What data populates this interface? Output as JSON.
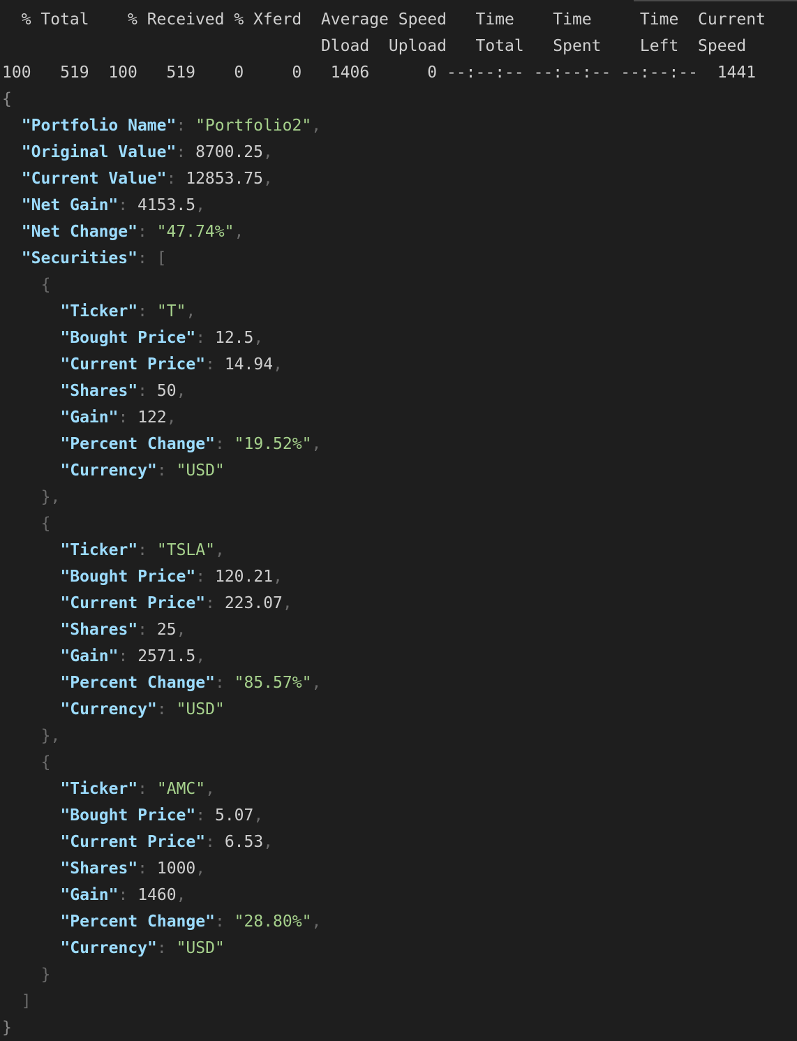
{
  "terminal": {
    "header_line_1": "  % Total    % Received % Xferd  Average Speed   Time    Time     Time  Current",
    "header_line_2": "                                 Dload  Upload   Total   Spent    Left  Speed",
    "progress_line": "100   519  100   519    0     0   1406      0 --:--:-- --:--:-- --:--:--  1441"
  },
  "json": {
    "open_brace": "{",
    "portfolio_fields": [
      {
        "key": "\"Portfolio Name\"",
        "value": "\"Portfolio2\"",
        "type": "str",
        "comma": ","
      },
      {
        "key": "\"Original Value\"",
        "value": "8700.25",
        "type": "num",
        "comma": ","
      },
      {
        "key": "\"Current Value\"",
        "value": "12853.75",
        "type": "num",
        "comma": ","
      },
      {
        "key": "\"Net Gain\"",
        "value": "4153.5",
        "type": "num",
        "comma": ","
      },
      {
        "key": "\"Net Change\"",
        "value": "\"47.74%\"",
        "type": "str",
        "comma": ","
      }
    ],
    "securities_key": "\"Securities\"",
    "securities_open": "[",
    "securities": [
      {
        "open": "{",
        "fields": [
          {
            "key": "\"Ticker\"",
            "value": "\"T\"",
            "type": "str",
            "comma": ","
          },
          {
            "key": "\"Bought Price\"",
            "value": "12.5",
            "type": "num",
            "comma": ","
          },
          {
            "key": "\"Current Price\"",
            "value": "14.94",
            "type": "num",
            "comma": ","
          },
          {
            "key": "\"Shares\"",
            "value": "50",
            "type": "num",
            "comma": ","
          },
          {
            "key": "\"Gain\"",
            "value": "122",
            "type": "num",
            "comma": ","
          },
          {
            "key": "\"Percent Change\"",
            "value": "\"19.52%\"",
            "type": "str",
            "comma": ","
          },
          {
            "key": "\"Currency\"",
            "value": "\"USD\"",
            "type": "str",
            "comma": ""
          }
        ],
        "close": "},"
      },
      {
        "open": "{",
        "fields": [
          {
            "key": "\"Ticker\"",
            "value": "\"TSLA\"",
            "type": "str",
            "comma": ","
          },
          {
            "key": "\"Bought Price\"",
            "value": "120.21",
            "type": "num",
            "comma": ","
          },
          {
            "key": "\"Current Price\"",
            "value": "223.07",
            "type": "num",
            "comma": ","
          },
          {
            "key": "\"Shares\"",
            "value": "25",
            "type": "num",
            "comma": ","
          },
          {
            "key": "\"Gain\"",
            "value": "2571.5",
            "type": "num",
            "comma": ","
          },
          {
            "key": "\"Percent Change\"",
            "value": "\"85.57%\"",
            "type": "str",
            "comma": ","
          },
          {
            "key": "\"Currency\"",
            "value": "\"USD\"",
            "type": "str",
            "comma": ""
          }
        ],
        "close": "},"
      },
      {
        "open": "{",
        "fields": [
          {
            "key": "\"Ticker\"",
            "value": "\"AMC\"",
            "type": "str",
            "comma": ","
          },
          {
            "key": "\"Bought Price\"",
            "value": "5.07",
            "type": "num",
            "comma": ","
          },
          {
            "key": "\"Current Price\"",
            "value": "6.53",
            "type": "num",
            "comma": ","
          },
          {
            "key": "\"Shares\"",
            "value": "1000",
            "type": "num",
            "comma": ","
          },
          {
            "key": "\"Gain\"",
            "value": "1460",
            "type": "num",
            "comma": ","
          },
          {
            "key": "\"Percent Change\"",
            "value": "\"28.80%\"",
            "type": "str",
            "comma": ","
          },
          {
            "key": "\"Currency\"",
            "value": "\"USD\"",
            "type": "str",
            "comma": ""
          }
        ],
        "close": "}"
      }
    ],
    "securities_close": "]",
    "close_brace": "}"
  }
}
